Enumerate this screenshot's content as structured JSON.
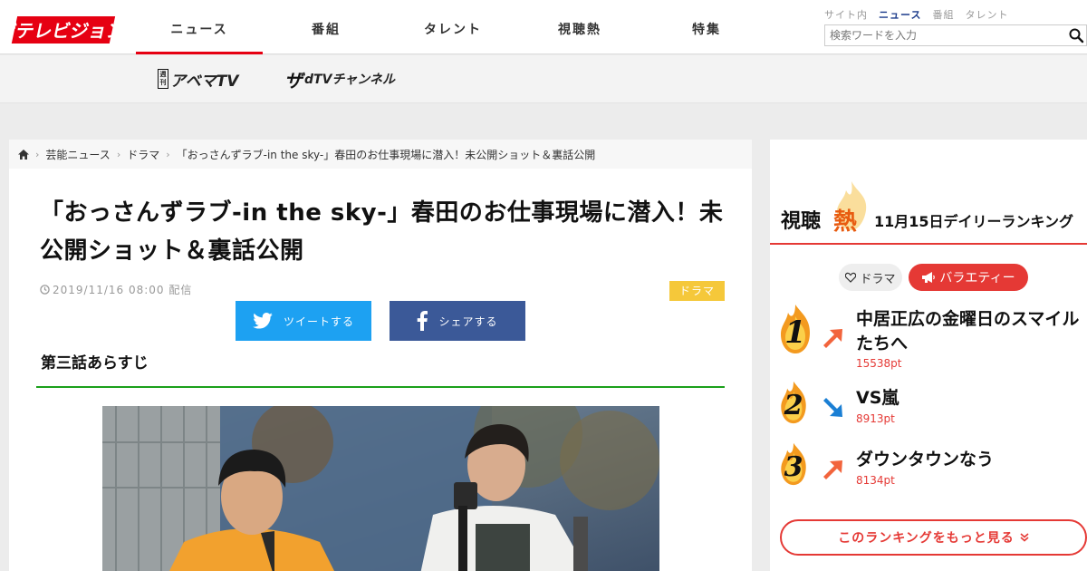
{
  "site": {
    "logo_text": "ザテレビジョン"
  },
  "nav": {
    "items": [
      {
        "label": "ニュース",
        "active": true
      },
      {
        "label": "番組"
      },
      {
        "label": "タレント"
      },
      {
        "label": "視聴熱"
      },
      {
        "label": "特集"
      }
    ]
  },
  "search": {
    "tabs": [
      "サイト内",
      "ニュース",
      "番組",
      "タレント"
    ],
    "active_tab": "ニュース",
    "placeholder": "検索ワードを入力",
    "icon": "search-icon"
  },
  "subnav": {
    "abema": {
      "badge": "週刊",
      "label": "アベマTV"
    },
    "dtv": {
      "badge": "ザ",
      "label": "dTVチャンネル"
    }
  },
  "breadcrumb": [
    "芸能ニュース",
    "ドラマ",
    "「おっさんずラブ-in the sky-」春田のお仕事現場に潜入！未公開ショット＆裏話公開"
  ],
  "article": {
    "title": "「おっさんずラブ-in the sky-」春田のお仕事現場に潜入！未公開ショット＆裏話公開",
    "date": "2019/11/16 08:00 配信",
    "tag": "ドラマ",
    "tweet_label": "ツイートする",
    "share_label": "シェアする",
    "section_heading": "第三話あらすじ"
  },
  "ranking": {
    "title_prefix": "視聴",
    "title_mark": "熱",
    "title_suffix": "11月15日デイリーランキング",
    "filters": [
      {
        "label": "ドラマ",
        "icon": "heart-icon",
        "active": false
      },
      {
        "label": "バラエティー",
        "icon": "megaphone-icon",
        "active": true
      }
    ],
    "items": [
      {
        "rank": "1",
        "name": "中居正広の金曜日のスマイルたちへ",
        "points": "15538pt",
        "trend": "up"
      },
      {
        "rank": "2",
        "name": "VS嵐",
        "points": "8913pt",
        "trend": "down"
      },
      {
        "rank": "3",
        "name": "ダウンタウンなう",
        "points": "8134pt",
        "trend": "up"
      }
    ],
    "more_label": "このランキングをもっと見る",
    "colors": {
      "accent": "#e53935",
      "flame": "#f08a1a",
      "up": "#f2643c",
      "down": "#1a7fd4"
    }
  }
}
